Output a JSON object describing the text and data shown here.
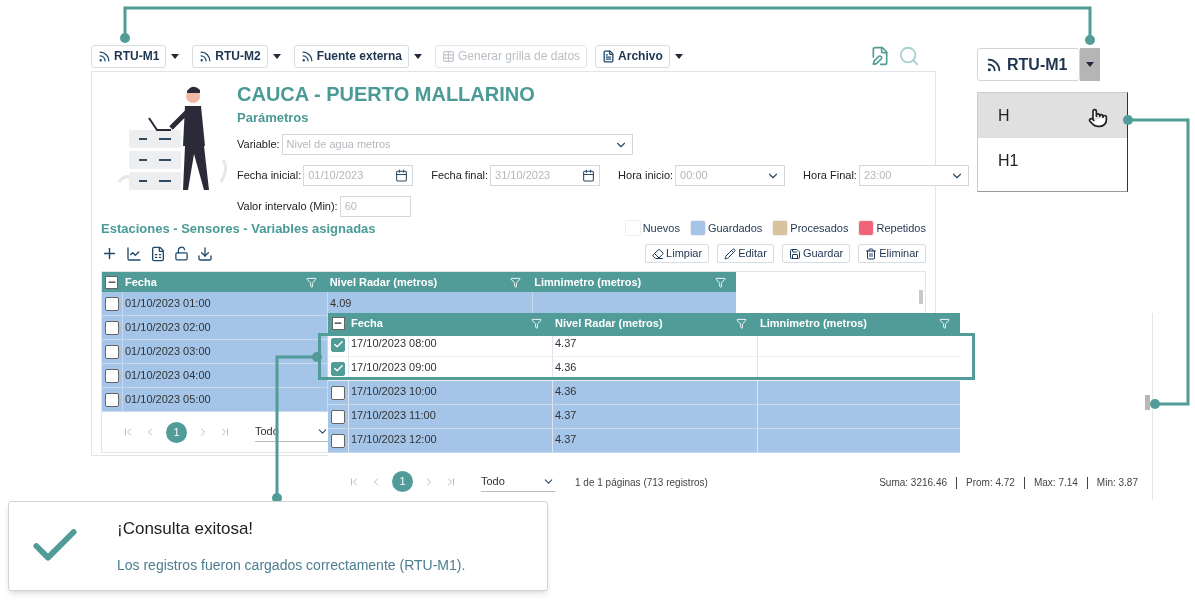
{
  "toolbar": {
    "buttons": [
      {
        "label": "RTU-M1",
        "kind": "feed",
        "disabled": false,
        "menu": true
      },
      {
        "label": "RTU-M2",
        "kind": "feed",
        "disabled": false,
        "menu": true
      },
      {
        "label": "Fuente externa",
        "kind": "feed",
        "disabled": false,
        "menu": true
      },
      {
        "label": "Generar grilla de datos",
        "kind": "grid",
        "disabled": true,
        "menu": false
      },
      {
        "label": "Archivo",
        "kind": "file",
        "disabled": false,
        "menu": true
      }
    ]
  },
  "header": {
    "title": "CAUCA - PUERTO MALLARINO",
    "subtitle": "Parámetros"
  },
  "form": {
    "rows": [
      [
        {
          "label": "Variable:",
          "placeholder": "Nivel de agua metros",
          "kind": "select"
        }
      ],
      [
        {
          "label": "Fecha inicial:",
          "placeholder": "01/10/2023",
          "kind": "date"
        },
        {
          "label": "Fecha final:",
          "placeholder": "31/10/2023",
          "kind": "date"
        },
        {
          "label": "Hora inicio:",
          "placeholder": "00:00",
          "kind": "select"
        },
        {
          "label": "Hora Final:",
          "placeholder": "23:00",
          "kind": "select"
        }
      ],
      [
        {
          "label": "Valor intervalo (Min):",
          "placeholder": "60",
          "kind": "text"
        }
      ]
    ]
  },
  "section_title": "Estaciones - Sensores - Variables asignadas",
  "legend": [
    {
      "label": "Nuevos",
      "color": "#ffffff"
    },
    {
      "label": "Guardados",
      "color": "#a4c4e8"
    },
    {
      "label": "Procesados",
      "color": "#d8c39c"
    },
    {
      "label": "Repetidos",
      "color": "#f2627b"
    }
  ],
  "actions": [
    {
      "label": "Limpiar",
      "kind": "clear"
    },
    {
      "label": "Editar",
      "kind": "edit"
    },
    {
      "label": "Guardar",
      "kind": "save"
    },
    {
      "label": "Eliminar",
      "kind": "delete"
    }
  ],
  "grid": {
    "select_all_partial": true,
    "columns": [
      "Fecha",
      "Nivel Radar (metros)",
      "Limnimetro (metros)"
    ],
    "rows": [
      {
        "fecha": "01/10/2023 01:00",
        "nivel": "4.09",
        "checked": false
      },
      {
        "fecha": "01/10/2023 02:00",
        "checked": false
      },
      {
        "fecha": "01/10/2023 03:00",
        "checked": false
      },
      {
        "fecha": "01/10/2023 04:00",
        "checked": false
      },
      {
        "fecha": "01/10/2023 05:00",
        "checked": false
      }
    ],
    "pager": {
      "page": "1",
      "page_size": "Todo"
    }
  },
  "zoom_grid": {
    "select_all_partial": true,
    "columns": [
      "Fecha",
      "Nivel Radar (metros)",
      "Limnimetro (metros)"
    ],
    "rows": [
      {
        "fecha": "17/10/2023 08:00",
        "nivel": "4.37",
        "checked": true
      },
      {
        "fecha": "17/10/2023 09:00",
        "nivel": "4.36",
        "checked": true
      },
      {
        "fecha": "17/10/2023 10:00",
        "nivel": "4.36",
        "checked": false
      },
      {
        "fecha": "17/10/2023 11:00",
        "nivel": "4.37",
        "checked": false
      },
      {
        "fecha": "17/10/2023 12:00",
        "nivel": "4.37",
        "checked": false
      }
    ],
    "pager": {
      "page": "1",
      "page_size": "Todo",
      "summary": "1 de 1 páginas (713 registros)"
    },
    "stats": [
      "Suma: 3216.46",
      "Prom: 4.72",
      "Max: 7.14",
      "Min: 3.87"
    ]
  },
  "dropdown": {
    "button": "RTU-M1",
    "options": [
      {
        "label": "H",
        "selected": true
      },
      {
        "label": "H1",
        "selected": false
      }
    ]
  },
  "toast": {
    "title": "¡Consulta exitosa!",
    "message": "Los registros fueron cargados correctamente (RTU-M1)."
  }
}
